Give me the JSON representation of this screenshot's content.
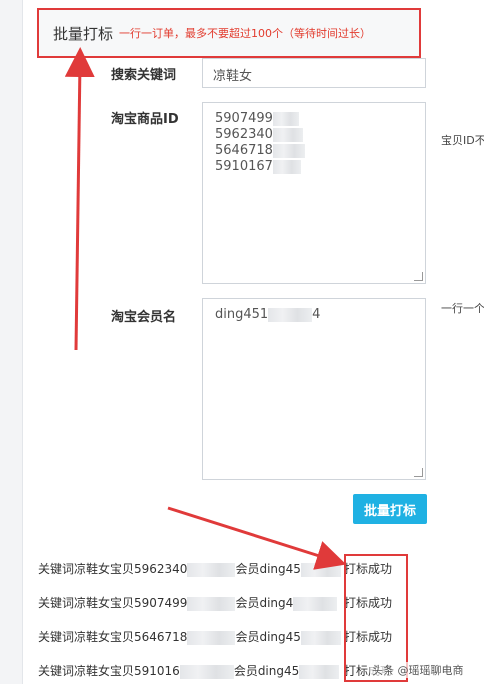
{
  "header": {
    "title": "批量打标",
    "note": "一行一订单，最多不要超过100个（等待时间过长）"
  },
  "form": {
    "keyword_label": "搜索关键词",
    "keyword_value": "凉鞋女",
    "item_id_label": "淘宝商品ID",
    "item_ids": [
      "5907499",
      "5962340",
      "5646718",
      "5910167"
    ],
    "item_id_hint": "宝贝ID不",
    "member_label": "淘宝会员名",
    "members": [
      "ding451",
      "4"
    ],
    "member_hint": "一行一个",
    "submit_label": "批量打标"
  },
  "results": [
    {
      "prefix": "关键词凉鞋女宝贝5962340",
      "mid": "会员ding45",
      "status": "打标成功"
    },
    {
      "prefix": "关键词凉鞋女宝贝5907499",
      "mid": "会员ding4",
      "status": "打标成功"
    },
    {
      "prefix": "关键词凉鞋女宝贝5646718",
      "mid": "会员ding45",
      "status": "打标成功"
    },
    {
      "prefix": "关键词凉鞋女宝贝591016",
      "mid": "会员ding45",
      "status": "打标成功"
    }
  ],
  "watermark": "头条 @瑶瑶聊电商",
  "colors": {
    "annotation_red": "#e03a3a",
    "button_blue": "#1fb1e3",
    "note_red": "#e23b2e"
  }
}
